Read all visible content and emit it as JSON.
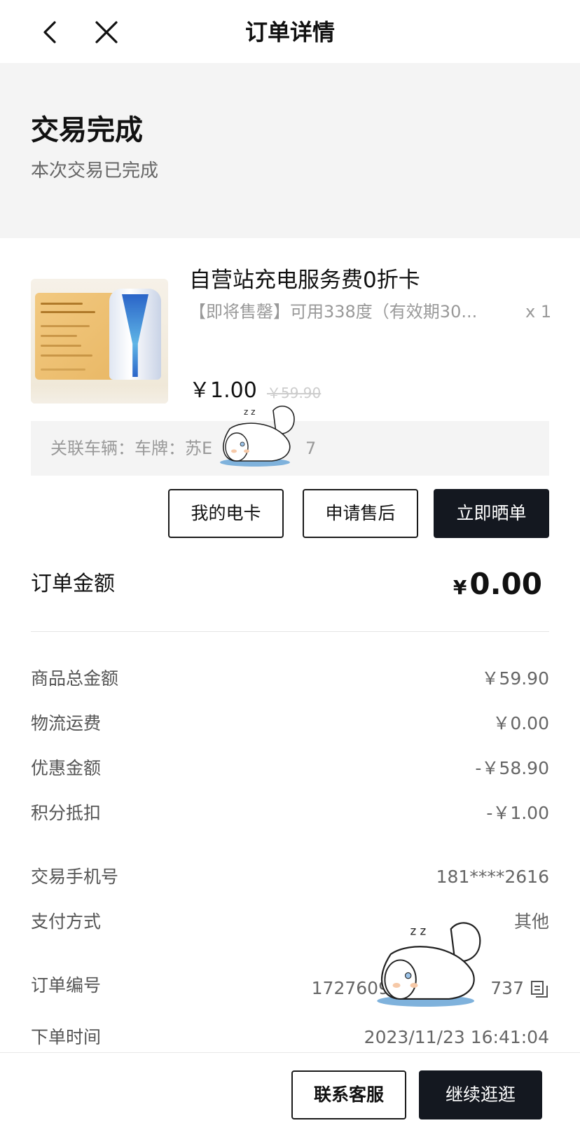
{
  "nav": {
    "title": "订单详情",
    "back_icon": "chevron-left-icon",
    "close_icon": "close-icon"
  },
  "status": {
    "title": "交易完成",
    "subtitle": "本次交易已完成"
  },
  "product": {
    "name": "自营站充电服务费0折卡",
    "spec": "【即将售罄】可用338度（有效期30...",
    "quantity": "x 1",
    "price": "￥1.00",
    "original_price": "￥59.90",
    "image_text": [
      "小鹏自营站",
      "充电服务费0折卡"
    ]
  },
  "vehicle": {
    "text": "关联车辆：车牌：苏E",
    "text_tail": "7"
  },
  "actions": {
    "my_card": "我的电卡",
    "after_sale": "申请售后",
    "share_review": "立即晒单"
  },
  "order_amount": {
    "label": "订单金额",
    "currency": "¥",
    "value": "0.00"
  },
  "breakdown": [
    {
      "label": "商品总金额",
      "value": "￥59.90"
    },
    {
      "label": "物流运费",
      "value": "￥0.00"
    },
    {
      "label": "优惠金额",
      "value": "-￥58.90"
    },
    {
      "label": "积分抵扣",
      "value": "-￥1.00"
    }
  ],
  "info": [
    {
      "label": "交易手机号",
      "value": "181****2616"
    },
    {
      "label": "支付方式",
      "value": "其他"
    },
    {
      "label": "订单编号",
      "value": "1727609",
      "value_tail": "737"
    },
    {
      "label": "下单时间",
      "value": "2023/11/23 16:41:04"
    }
  ],
  "bottom": {
    "contact": "联系客服",
    "continue": "继续逛逛"
  },
  "colors": {
    "dark_button": "#141820",
    "gray_panel": "#f4f4f4"
  }
}
